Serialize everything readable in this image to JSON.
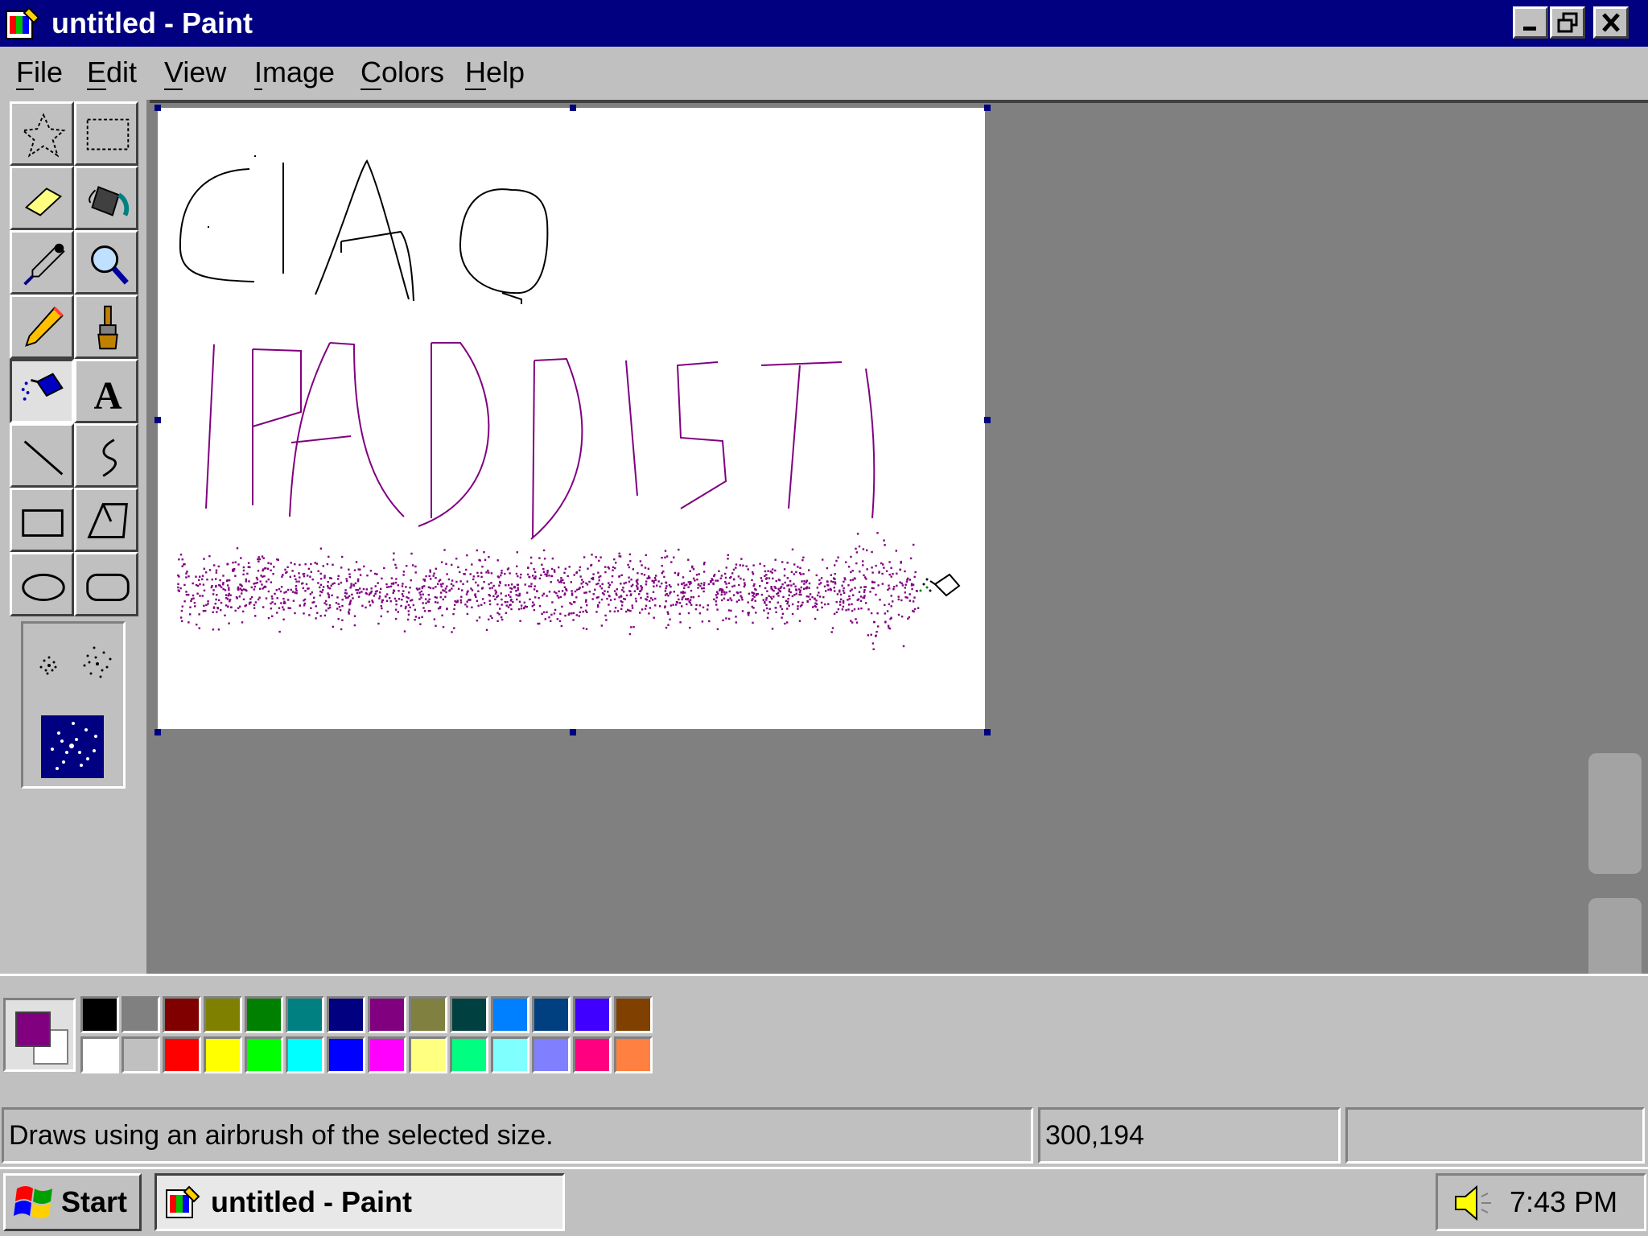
{
  "window": {
    "title": "untitled - Paint"
  },
  "menu": {
    "items": [
      "File",
      "Edit",
      "View",
      "Image",
      "Colors",
      "Help"
    ],
    "underlines": [
      "F",
      "E",
      "V",
      "I",
      "C",
      "H"
    ]
  },
  "toolbox": {
    "tools": [
      "free-form-select",
      "select",
      "eraser",
      "fill-with-color",
      "pick-color",
      "magnifier",
      "pencil",
      "brush",
      "airbrush",
      "text",
      "line",
      "curve",
      "rectangle",
      "polygon",
      "ellipse",
      "rounded-rectangle"
    ],
    "selected": "airbrush",
    "options": [
      "airbrush-small",
      "airbrush-medium",
      "airbrush-large"
    ],
    "selected_option": "airbrush-large"
  },
  "canvas": {
    "drawing_lines": [
      {
        "text": "CIAO",
        "color": "#000000"
      },
      {
        "text": "IPADDISTI",
        "color": "#800080"
      }
    ],
    "spray_color": "#800080"
  },
  "colors": {
    "foreground": "#800080",
    "background": "#ffffff",
    "row1": [
      "#000000",
      "#808080",
      "#800000",
      "#808000",
      "#008000",
      "#008080",
      "#000080",
      "#800080",
      "#808040",
      "#004040",
      "#0080ff",
      "#004080",
      "#4000ff",
      "#804000"
    ],
    "row2": [
      "#ffffff",
      "#c0c0c0",
      "#ff0000",
      "#ffff00",
      "#00ff00",
      "#00ffff",
      "#0000ff",
      "#ff00ff",
      "#ffff80",
      "#00ff80",
      "#80ffff",
      "#8080ff",
      "#ff0080",
      "#ff8040"
    ]
  },
  "status": {
    "message": "Draws using an airbrush of the selected size.",
    "coordinates": "300,194",
    "size": ""
  },
  "taskbar": {
    "start_label": "Start",
    "task_label": "untitled - Paint",
    "clock": "7:43 PM"
  }
}
